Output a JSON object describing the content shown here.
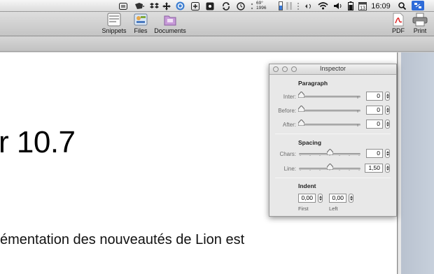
{
  "menubar": {
    "weather_temp": "69°",
    "weather_year": "1996",
    "clock": "16:09"
  },
  "toolbar": {
    "snippets": "Snippets",
    "files": "Files",
    "documents": "Documents",
    "pdf": "PDF",
    "print": "Print"
  },
  "document": {
    "heading": "r 10.7",
    "paragraph": "émentation des nouveautés de Lion est"
  },
  "inspector": {
    "title": "Inspector",
    "paragraph_section": "Paragraph",
    "inter_label": "Inter:",
    "inter_value": "0",
    "before_label": "Before:",
    "before_value": "0",
    "after_label": "After:",
    "after_value": "0",
    "spacing_section": "Spacing",
    "chars_label": "Chars:",
    "chars_value": "0",
    "line_label": "Line:",
    "line_value": "1,50",
    "indent_section": "Indent",
    "first_value": "0,00",
    "left_value": "0,00",
    "first_label": "First",
    "left_label": "Left"
  }
}
